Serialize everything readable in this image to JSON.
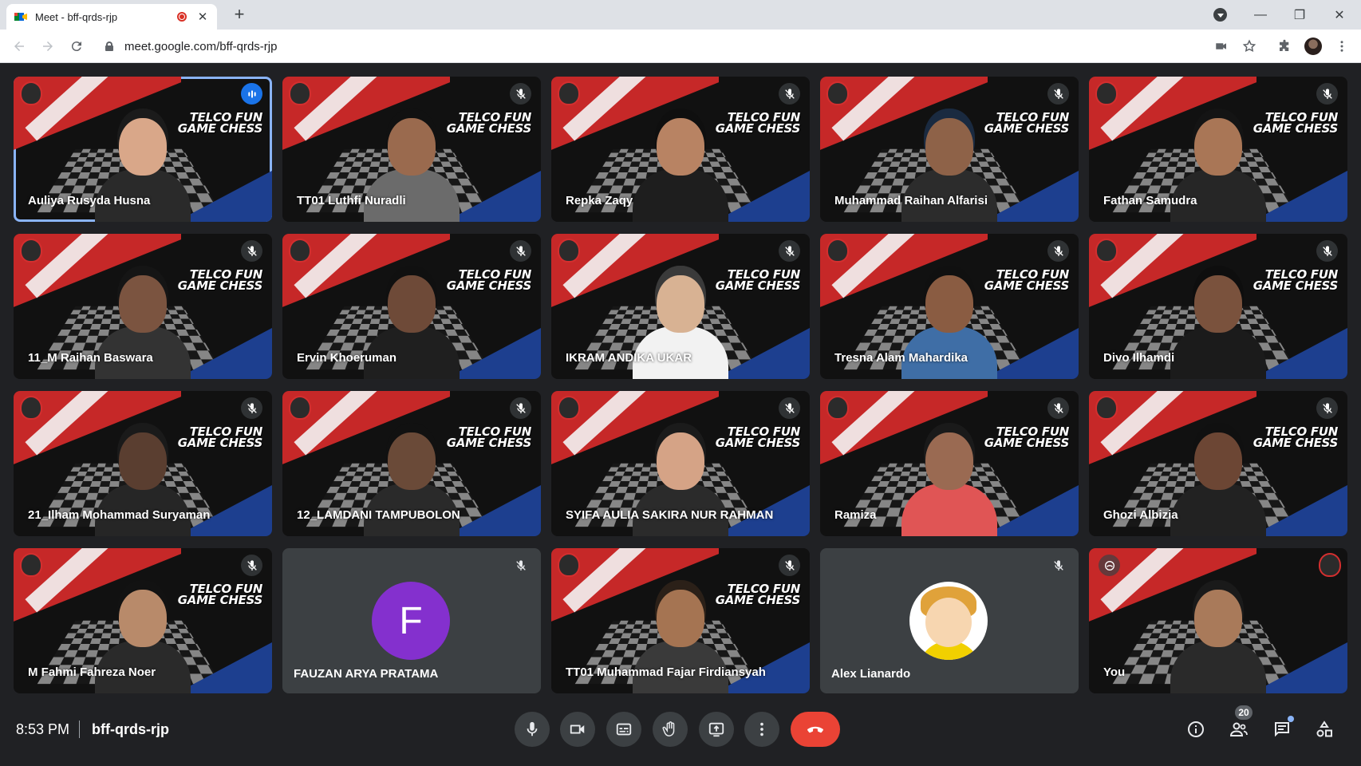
{
  "browser": {
    "tab_title": "Meet - bff-qrds-rjp",
    "close_tab_glyph": "✕",
    "new_tab_glyph": "+",
    "url": "meet.google.com/bff-qrds-rjp",
    "window_controls": [
      "—",
      "❐",
      "✕"
    ]
  },
  "participants": [
    {
      "name": "Auliya Rusyda Husna",
      "status": "speaking",
      "hair": "#1b1b1b",
      "skin": "#d9a789",
      "shirt": "#2a2a2a"
    },
    {
      "name": "TT01 Luthfi Nuradli",
      "status": "muted",
      "hair": "#111111",
      "skin": "#9a6a4e",
      "shirt": "#6b6b6b"
    },
    {
      "name": "Repka Zaqy",
      "status": "muted",
      "hair": "#0f0f0f",
      "skin": "#b88363",
      "shirt": "#1e1e1e"
    },
    {
      "name": "Muhammad Raihan Alfarisi",
      "status": "muted",
      "hair": "#1a2a40",
      "skin": "#8e6248",
      "shirt": "#2c2c2c"
    },
    {
      "name": "Fathan Samudra",
      "status": "muted",
      "hair": "#141414",
      "skin": "#a97656",
      "shirt": "#262626"
    },
    {
      "name": "11_M Raihan Baswara",
      "status": "muted",
      "hair": "#151515",
      "skin": "#7b5440",
      "shirt": "#333333"
    },
    {
      "name": "Ervin Khoeruman",
      "status": "muted",
      "hair": "#101010",
      "skin": "#6e4a38",
      "shirt": "#1f1f1f"
    },
    {
      "name": "IKRAM ANDIKA UKAR",
      "status": "muted",
      "hair": "#3a3a3a",
      "skin": "#d8b293",
      "shirt": "#f2f2f2"
    },
    {
      "name": "Tresna Alam Mahardika",
      "status": "muted",
      "hair": "#101010",
      "skin": "#8a5c42",
      "shirt": "#3f6ea6"
    },
    {
      "name": "Divo Ilhamdi",
      "status": "muted",
      "hair": "#0e0e0e",
      "skin": "#7a523d",
      "shirt": "#1b1b1b"
    },
    {
      "name": "21_Ilham Mohammad Suryaman",
      "status": "muted",
      "hair": "#1a1a1a",
      "skin": "#5a3e30",
      "shirt": "#262626"
    },
    {
      "name": "12_LAMDANI TAMPUBOLON",
      "status": "muted",
      "hair": "#111111",
      "skin": "#6a4a38",
      "shirt": "#2a2a2a"
    },
    {
      "name": "SYIFA AULIA SAKIRA NUR RAHMAN",
      "status": "muted",
      "hair": "#1b1b1b",
      "skin": "#d5a386",
      "shirt": "#2b2b2b"
    },
    {
      "name": "Ramiza",
      "status": "muted",
      "hair": "#1a1a1a",
      "skin": "#9a6a52",
      "shirt": "#e05555"
    },
    {
      "name": "Ghozi Albizia",
      "status": "muted",
      "hair": "#101010",
      "skin": "#6c4634",
      "shirt": "#222222"
    },
    {
      "name": "M Fahmi Fahreza Noer",
      "status": "muted",
      "hair": "#121212",
      "skin": "#b88a6a",
      "shirt": "#2a2a2a"
    },
    {
      "name": "FAUZAN ARYA PRATAMA",
      "status": "no-video",
      "initial": "F"
    },
    {
      "name": "TT01 Muhammad Fajar Firdiansyah",
      "status": "muted",
      "hair": "#2b2018",
      "skin": "#a57452",
      "shirt": "#3a3a3a"
    },
    {
      "name": "Alex Lianardo",
      "status": "no-video-photo"
    },
    {
      "name": "You",
      "status": "self",
      "hair": "#1a1a1a",
      "skin": "#a97a5a",
      "shirt": "#2a2a2a"
    }
  ],
  "banner_text": [
    "TELCO FUN",
    "GAME CHESS"
  ],
  "meeting": {
    "time": "8:53 PM",
    "code": "bff-qrds-rjp",
    "participant_count": "20"
  },
  "colors": {
    "hangup": "#ea4335",
    "speaking_outline": "#8ab4f8",
    "avatar_purple": "#8430ce",
    "speaking_badge": "#1a73e8"
  },
  "icons": {
    "tabstrip": [
      "meet-favicon",
      "recording-icon",
      "close-icon",
      "new-tab-icon",
      "profile-menu-icon",
      "minimize-icon",
      "restore-icon",
      "close-window-icon"
    ],
    "toolbar": [
      "back-icon",
      "forward-icon",
      "reload-icon",
      "lock-icon",
      "camera-blocked-icon",
      "star-icon",
      "extensions-icon",
      "profile-avatar",
      "more-menu-icon"
    ],
    "controls": [
      "mic-icon",
      "camera-icon",
      "captions-icon",
      "raise-hand-icon",
      "present-icon",
      "more-options-icon",
      "hangup-icon"
    ],
    "side": [
      "info-icon",
      "people-icon",
      "chat-icon",
      "activities-icon"
    ]
  }
}
